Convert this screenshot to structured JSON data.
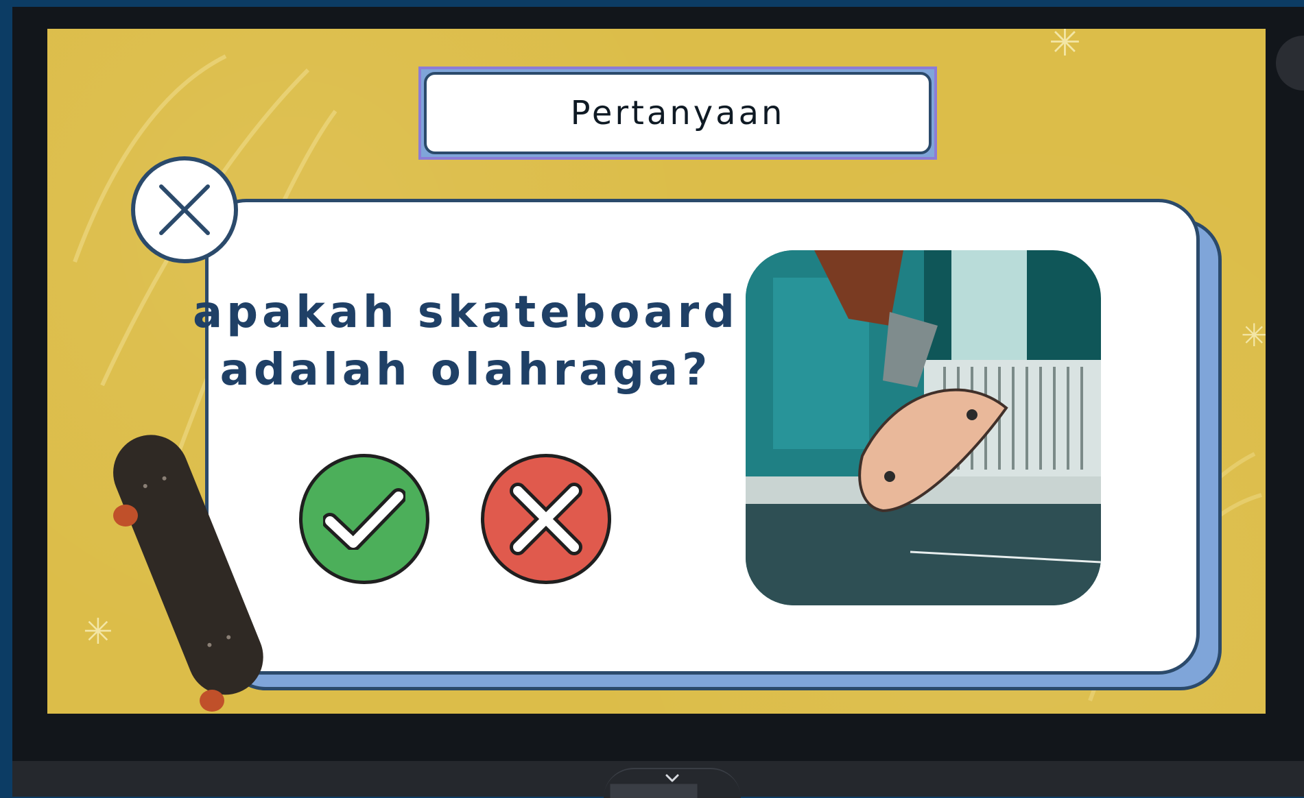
{
  "slide": {
    "title": "Pertanyaan",
    "question_line1": "apakah skateboard",
    "question_line2": "adalah olahraga?"
  },
  "buttons": {
    "yes_icon": "checkmark-icon",
    "no_icon": "cross-icon",
    "close_icon": "close-icon"
  },
  "photo": {
    "subject": "skateboarder-photo"
  },
  "colors": {
    "background": "#dcbd49",
    "card_border": "#2b4a6b",
    "card_shadow": "#7fa5d9",
    "question_text": "#1f4066",
    "yes": "#4caf5a",
    "no": "#e05a4d",
    "title_outline": "#8c7cd6"
  },
  "bottom": {
    "collapse_icon": "chevron-down-icon"
  }
}
